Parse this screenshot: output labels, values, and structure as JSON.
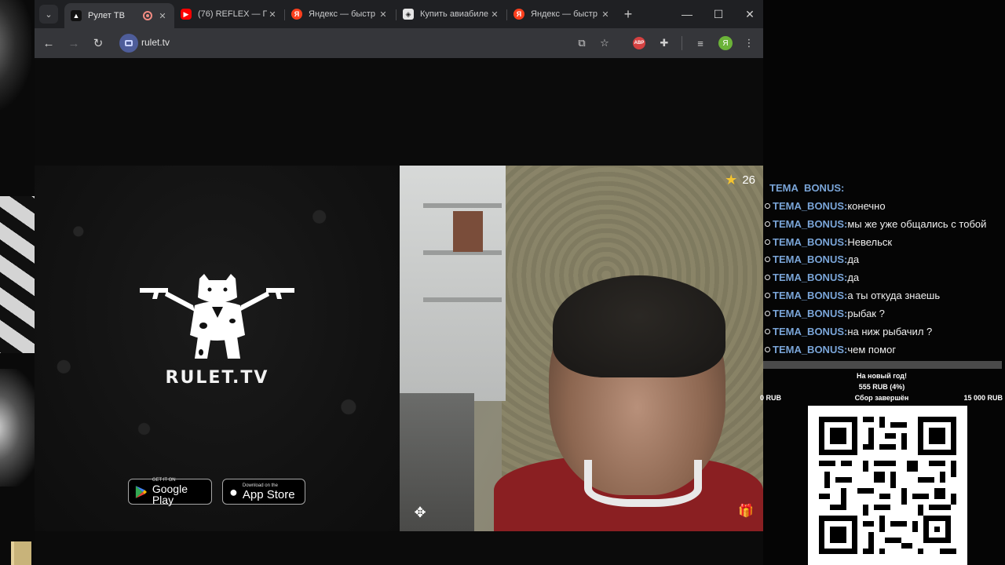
{
  "browser": {
    "tabs": [
      {
        "title": "Рулет ТВ",
        "favicon": "rulet-icon",
        "active": true,
        "recording": true
      },
      {
        "title": "(76) REFLEX — П",
        "favicon": "youtube-icon"
      },
      {
        "title": "Яндекс — быстр",
        "favicon": "yandex-icon"
      },
      {
        "title": "Купить авиабиле",
        "favicon": "ticket-icon"
      },
      {
        "title": "Яндекс — быстр",
        "favicon": "yandex-icon"
      }
    ],
    "url": "rulet.tv",
    "abp_label": "ABP",
    "avatar_letter": "Я"
  },
  "promo": {
    "brand": "RULET.TV",
    "google_play": {
      "small": "GET IT ON",
      "big": "Google Play"
    },
    "app_store": {
      "small": "Download on the",
      "big": "App Store"
    }
  },
  "video": {
    "rating": "26"
  },
  "chat": {
    "clipped_user": "TEMA_BONUS:",
    "messages": [
      {
        "user": "TEMA_BONUS:",
        "text": "конечно"
      },
      {
        "user": "TEMA_BONUS:",
        "text": "мы же уже общались с тобой"
      },
      {
        "user": "TEMA_BONUS:",
        "text": "Невельск"
      },
      {
        "user": "TEMA_BONUS:",
        "text": "да"
      },
      {
        "user": "TEMA_BONUS:",
        "text": "да"
      },
      {
        "user": "TEMA_BONUS:",
        "text": "а ты откуда знаешь"
      },
      {
        "user": "TEMA_BONUS:",
        "text": "рыбак ?"
      },
      {
        "user": "TEMA_BONUS:",
        "text": "на ниж рыбачил ?"
      },
      {
        "user": "TEMA_BONUS:",
        "text": "чем помог"
      }
    ]
  },
  "donation_goal": {
    "title": "На новый год!",
    "raised": "555 RUB (4%)",
    "min": "0 RUB",
    "status": "Сбор завершён",
    "max": "15 000 RUB"
  },
  "colors": {
    "chat_username": "#7aa5d8",
    "star": "#f4c430",
    "shirt": "#8a1f22"
  }
}
